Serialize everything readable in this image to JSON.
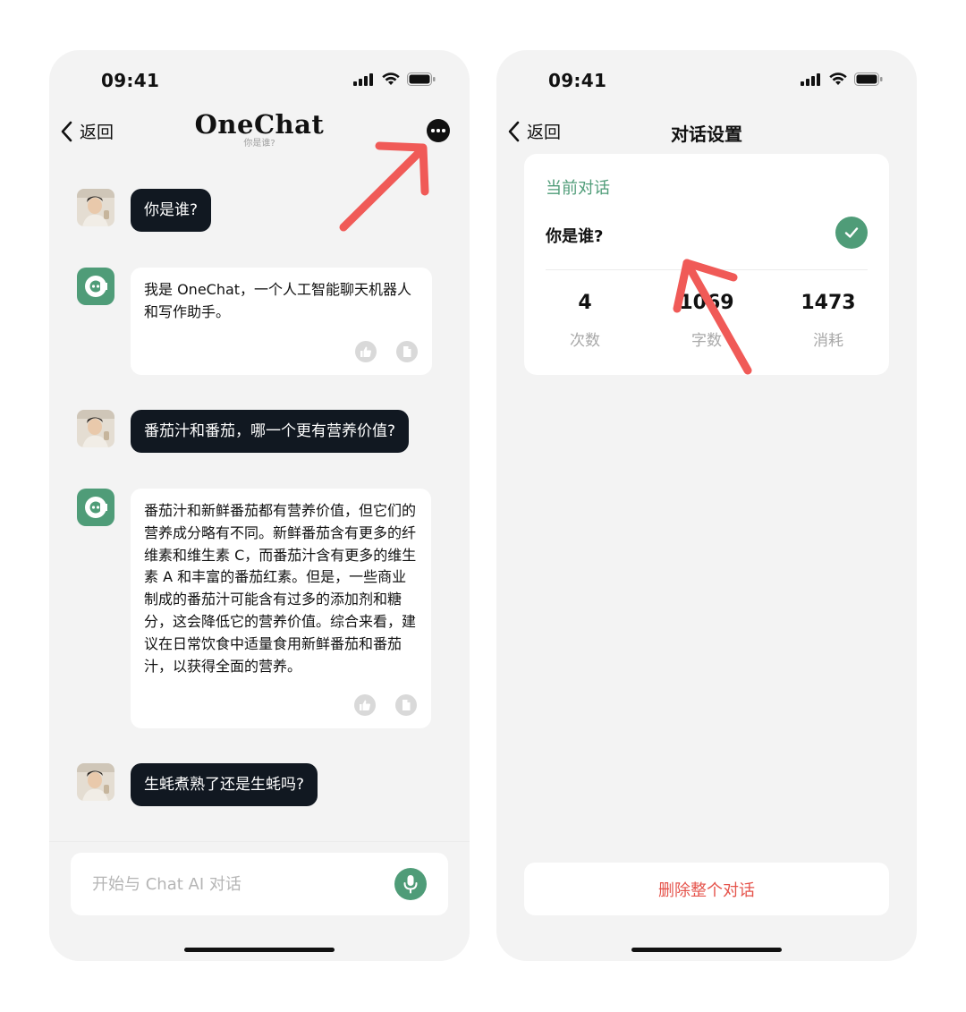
{
  "accent": "#4f9c78",
  "danger": "#e5534b",
  "annotation_color": "#f05a57",
  "left_screen": {
    "status_time": "09:41",
    "back_label": "返回",
    "brand": "OneChat",
    "subtitle": "你是谁?",
    "more_icon": "more-dots-icon",
    "messages": [
      {
        "role": "user",
        "text": "你是谁?"
      },
      {
        "role": "bot",
        "text": "我是 OneChat，一个人工智能聊天机器人和写作助手。"
      },
      {
        "role": "user",
        "text": "番茄汁和番茄，哪一个更有营养价值?"
      },
      {
        "role": "bot",
        "text": "番茄汁和新鲜番茄都有营养价值，但它们的营养成分略有不同。新鲜番茄含有更多的纤维素和维生素 C，而番茄汁含有更多的维生素 A 和丰富的番茄红素。但是，一些商业制成的番茄汁可能含有过多的添加剂和糖分，这会降低它的营养价值。综合来看，建议在日常饮食中适量食用新鲜番茄和番茄汁，以获得全面的营养。"
      },
      {
        "role": "user",
        "text": "生蚝煮熟了还是生蚝吗?"
      }
    ],
    "input_placeholder": "开始与 Chat AI 对话",
    "mic_icon": "microphone-icon"
  },
  "right_screen": {
    "status_time": "09:41",
    "back_label": "返回",
    "title": "对话设置",
    "section_header": "当前对话",
    "conversation_name": "你是谁?",
    "stats": [
      {
        "value": "4",
        "label": "次数"
      },
      {
        "value": "1069",
        "label": "字数"
      },
      {
        "value": "1473",
        "label": "消耗"
      }
    ],
    "delete_label": "删除整个对话"
  }
}
